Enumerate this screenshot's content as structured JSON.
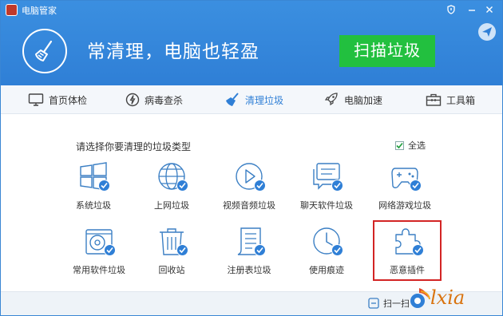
{
  "window": {
    "title": "电脑管家"
  },
  "header": {
    "slogan": "常清理，电脑也轻盈",
    "scan_button": "扫描垃圾"
  },
  "tabs": [
    {
      "label": "首页体检",
      "icon": "monitor-icon"
    },
    {
      "label": "病毒查杀",
      "icon": "shield-bolt-icon"
    },
    {
      "label": "清理垃圾",
      "icon": "broom-icon",
      "active": true
    },
    {
      "label": "电脑加速",
      "icon": "rocket-icon"
    },
    {
      "label": "工具箱",
      "icon": "toolbox-icon"
    }
  ],
  "content": {
    "prompt": "请选择你要清理的垃圾类型",
    "select_all": "全选",
    "items": [
      {
        "label": "系统垃圾",
        "icon": "windows-icon",
        "checked": true
      },
      {
        "label": "上网垃圾",
        "icon": "globe-icon",
        "checked": true
      },
      {
        "label": "视频音频垃圾",
        "icon": "play-icon",
        "checked": true
      },
      {
        "label": "聊天软件垃圾",
        "icon": "chat-icon",
        "checked": true
      },
      {
        "label": "网络游戏垃圾",
        "icon": "gamepad-icon",
        "checked": true
      },
      {
        "label": "常用软件垃圾",
        "icon": "disc-icon",
        "checked": true
      },
      {
        "label": "回收站",
        "icon": "trash-icon",
        "checked": true
      },
      {
        "label": "注册表垃圾",
        "icon": "registry-icon",
        "checked": true
      },
      {
        "label": "使用痕迹",
        "icon": "clock-icon",
        "checked": true
      },
      {
        "label": "恶意插件",
        "icon": "puzzle-icon",
        "checked": true
      }
    ]
  },
  "footer": {
    "item_label": "扫一扫"
  },
  "watermark": {
    "text": "lxia"
  },
  "colors": {
    "header_blue": "#2f7fd6",
    "scan_green": "#22c03f",
    "highlight_red": "#d32424",
    "check_blue": "#2f7fd6"
  }
}
